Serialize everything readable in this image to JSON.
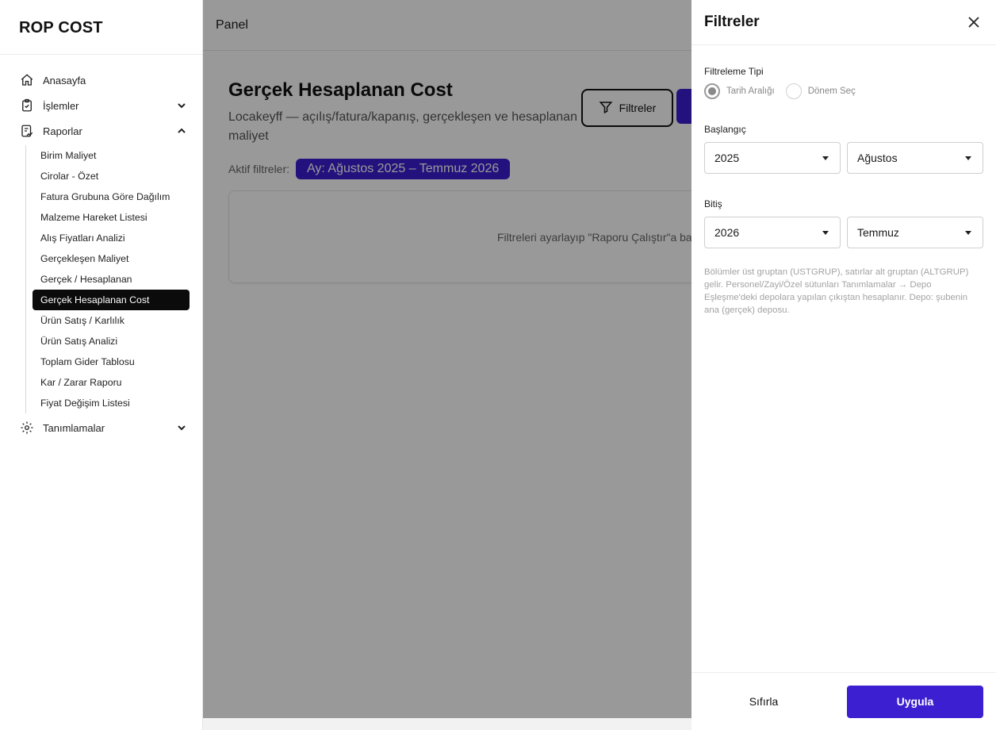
{
  "brand": "ROP COST",
  "sidebar": {
    "items": [
      {
        "label": "Anasayfa",
        "icon": "home-icon"
      },
      {
        "label": "İşlemler",
        "icon": "clipboard-icon"
      },
      {
        "label": "Raporlar",
        "icon": "report-icon"
      },
      {
        "label": "Tanımlamalar",
        "icon": "gear-icon"
      }
    ],
    "reports": [
      "Birim Maliyet",
      "Cirolar - Özet",
      "Fatura Grubuna Göre Dağılım",
      "Malzeme Hareket Listesi",
      "Alış Fiyatları Analizi",
      "Gerçekleşen Maliyet",
      "Gerçek / Hesaplanan",
      "Gerçek Hesaplanan Cost",
      "Ürün Satış / Karlılık",
      "Ürün Satış Analizi",
      "Toplam Gider Tablosu",
      "Kar / Zarar Raporu",
      "Fiyat Değişim Listesi"
    ],
    "active_report": "Gerçek Hesaplanan Cost"
  },
  "topbar": {
    "title": "Panel"
  },
  "page": {
    "title": "Gerçek Hesaplanan Cost",
    "subtitle": "Locakeyff — açılış/fatura/kapanış, gerçekleşen ve hesaplanan maliyet",
    "filters_button": "Filtreler",
    "active_filters_label": "Aktif filtreler:",
    "active_filter_chip": "Ay: Ağustos 2025 – Temmuz 2026",
    "empty_message": "Filtreleri ayarlayıp \"Raporu Çalıştır\"a bas"
  },
  "drawer": {
    "title": "Filtreler",
    "filter_type_label": "Filtreleme Tipi",
    "filter_type_options": [
      "Tarih Aralığı",
      "Dönem Seç"
    ],
    "filter_type_selected": "Tarih Aralığı",
    "start_label": "Başlangıç",
    "start_year": "2025",
    "start_month": "Ağustos",
    "end_label": "Bitiş",
    "end_year": "2026",
    "end_month": "Temmuz",
    "help_text": "Bölümler üst gruptan (USTGRUP), satırlar alt gruptan (ALTGRUP) gelir. Personel/Zayi/Özel sütunları Tanımlamalar → Depo Eşleşme'deki depolara yapılan çıkıştan hesaplanır. Depo: şubenin ana (gerçek) deposu.",
    "reset_label": "Sıfırla",
    "apply_label": "Uygula"
  },
  "colors": {
    "accent": "#3b1fd1",
    "active_nav": "#0b0b0b"
  }
}
